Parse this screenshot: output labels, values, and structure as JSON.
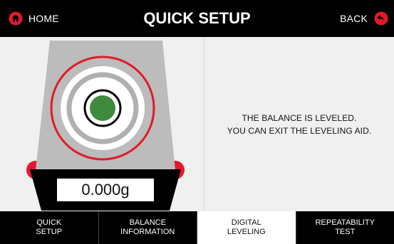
{
  "header": {
    "home_label": "HOME",
    "title": "QUICK SETUP",
    "back_label": "BACK",
    "icon_accent": "#e3192b"
  },
  "level": {
    "status": "leveled",
    "bubble_color": "#3f8a3f"
  },
  "display": {
    "weight": "0.000g"
  },
  "message": {
    "line1": "THE BALANCE IS LEVELED.",
    "line2": "YOU CAN EXIT THE LEVELING AID."
  },
  "tabs": [
    {
      "line1": "QUICK",
      "line2": "SETUP"
    },
    {
      "line1": "BALANCE",
      "line2": "INFORMATION"
    },
    {
      "line1": "DIGITAL",
      "line2": "LEVELING"
    },
    {
      "line1": "REPEATABILITY",
      "line2": "TEST"
    }
  ],
  "active_tab_index": 2
}
